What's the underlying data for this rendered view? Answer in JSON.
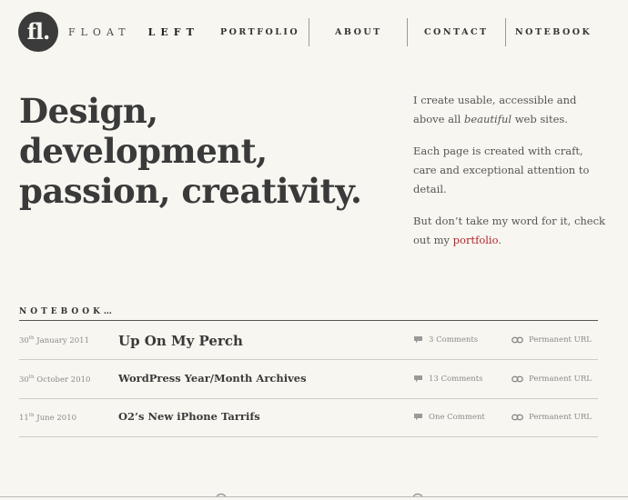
{
  "header": {
    "logo_mark": "fl.",
    "logo_word1": "FLOAT",
    "logo_word2": "LEFT",
    "nav": [
      {
        "label": "PORTFOLIO"
      },
      {
        "label": "ABOUT"
      },
      {
        "label": "CONTACT"
      },
      {
        "label": "NOTEBOOK"
      }
    ]
  },
  "hero": {
    "lines": [
      "Design,",
      "development,",
      "passion, creativity."
    ]
  },
  "intro": {
    "p1_part1": "I create usable, accessible and above all ",
    "p1_em": "beautiful",
    "p1_part2": " web sites.",
    "p2": "Each page is created with craft, care and exceptional attention to detail.",
    "p3_part1": "But don’t take my word for it, check out my ",
    "p3_link": "portfolio",
    "p3_part2": "."
  },
  "notebook": {
    "heading": "NOTEBOOK…",
    "entries": [
      {
        "day": "30",
        "suffix": "th",
        "month_year": " January 2011",
        "title": "Up On My Perch",
        "comments": "3 Comments",
        "permalink": "Permanent URL"
      },
      {
        "day": "30",
        "suffix": "th",
        "month_year": " October 2010",
        "title": "WordPress Year/Month Archives",
        "comments": "13 Comments",
        "permalink": "Permanent URL"
      },
      {
        "day": "11",
        "suffix": "th",
        "month_year": " June 2010",
        "title": "O2’s New iPhone Tarrifs",
        "comments": "One Comment",
        "permalink": "Permanent URL"
      }
    ]
  },
  "colors": {
    "background": "#f8f6f0",
    "text": "#3a3a3a",
    "accent_link": "#b3232b",
    "meta": "#8a8a8a"
  },
  "icons": {
    "comment": "speech-bubble-icon",
    "permalink": "chain-link-icon"
  }
}
